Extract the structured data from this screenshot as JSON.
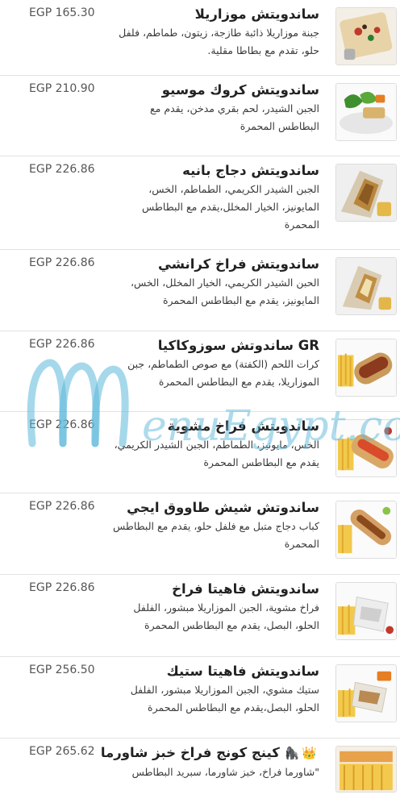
{
  "menu": {
    "items": [
      {
        "name": "ساندويتش موزاريلا",
        "desc": "جبنة موزاريلا ذائبة طازجة، زيتون، طماطم، فلفل حلو، تقدم مع بطاطا مقلية.",
        "price": "EGP 165.30",
        "thumb": "flatbread"
      },
      {
        "name": "ساندويتش كروك موسيو",
        "desc": "الجبن الشيدر، لحم بقري مدخن، يقدم مع البطاطس المحمرة",
        "price": "EGP 210.90",
        "thumb": "salad-plate"
      },
      {
        "name": "ساندويتش دجاج بانيه",
        "desc": "الجبن الشيدر الكريمي، الطماطم، الخس، المايونيز، الخيار المخلل،يقدم مع البطاطس المحمرة",
        "price": "EGP 226.86",
        "thumb": "wrap-sandwich"
      },
      {
        "name": "ساندويتش فراخ كرانشي",
        "desc": "الحبن الشيدر الكريمي، الخيار المخلل، الخس، المايونيز، يقدم مع البطاطس المحمرة",
        "price": "EGP 226.86",
        "thumb": "wrap-sandwich"
      },
      {
        "name": "GR ساندوتش سوزوكاكيا",
        "desc": "كرات اللحم (الكفتة) مع صوص الطماطم، جبن الموزاريلا، يقدم مع البطاطس المحمرة",
        "price": "EGP 226.86",
        "thumb": "sub-roll"
      },
      {
        "name": "ساندويتش فراخ مشوية",
        "desc": "الخس، مايونيز، الطماطم، الجبن الشيدر الكريمي، يقدم مع البطاطس المحمرة",
        "price": "EGP 226.86",
        "thumb": "sub-roll"
      },
      {
        "name": "ساندوتش شيش طاووق ايجي",
        "desc": "كباب دجاج متبل مع فلفل حلو، يقدم مع البطاطس المحمرة",
        "price": "EGP 226.86",
        "thumb": "hotdog"
      },
      {
        "name": "ساندويتش فاهيتا فراخ",
        "desc": "فراخ مشوية، الجبن الموزاريلا مبشور، الفلفل الحلو، البصل، يقدم مع البطاطس المحمرة",
        "price": "EGP 226.86",
        "thumb": "paper-wrap"
      },
      {
        "name": "ساندويتش فاهيتا ستيك",
        "desc": "ستيك مشوي، الجبن الموزاريلا مبشور، الفلفل الحلو، البصل،يقدم مع البطاطس المحمرة",
        "price": "EGP 256.50",
        "thumb": "paper-wrap"
      },
      {
        "name": "كينج كونج فراخ خبز شاورما",
        "desc": "\"شاورما فراخ، خبز شاورما، سبريد البطاطس",
        "price": "EGP 265.62",
        "thumb": "shawarma-box",
        "icons": [
          "crown-icon",
          "gorilla-icon"
        ]
      }
    ]
  },
  "watermark": {
    "text": "MenuEgypt.com",
    "color": "#5bb8d9"
  },
  "colors": {
    "divider": "#e2e2e2",
    "price": "#555555",
    "name": "#222222"
  }
}
